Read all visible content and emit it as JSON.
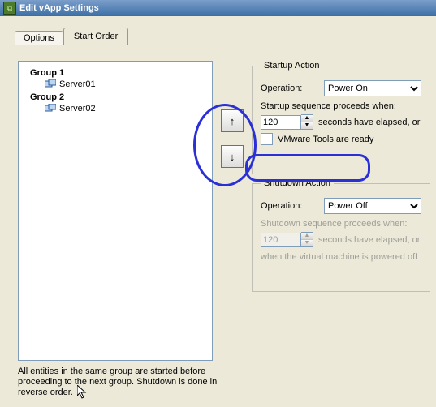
{
  "window": {
    "title": "Edit vApp Settings"
  },
  "tabs": {
    "options": "Options",
    "start_order": "Start Order"
  },
  "tree": {
    "group1": "Group 1",
    "server01": "Server01",
    "group2": "Group 2",
    "server02": "Server02"
  },
  "startup": {
    "legend": "Startup Action",
    "op_label": "Operation:",
    "op_value": "Power On",
    "note": "Startup sequence proceeds when:",
    "seconds": "120",
    "seconds_after": "seconds have elapsed, or",
    "vmtools": "VMware Tools are ready"
  },
  "shutdown": {
    "legend": "Shutdown Action",
    "op_label": "Operation:",
    "op_value": "Power Off",
    "note": "Shutdown sequence proceeds when:",
    "seconds": "120",
    "seconds_after": "seconds have elapsed, or",
    "line2": "when the virtual machine is powered off"
  },
  "footnote": "All entities in the same group are started before proceeding to the next group. Shutdown is done in reverse order."
}
